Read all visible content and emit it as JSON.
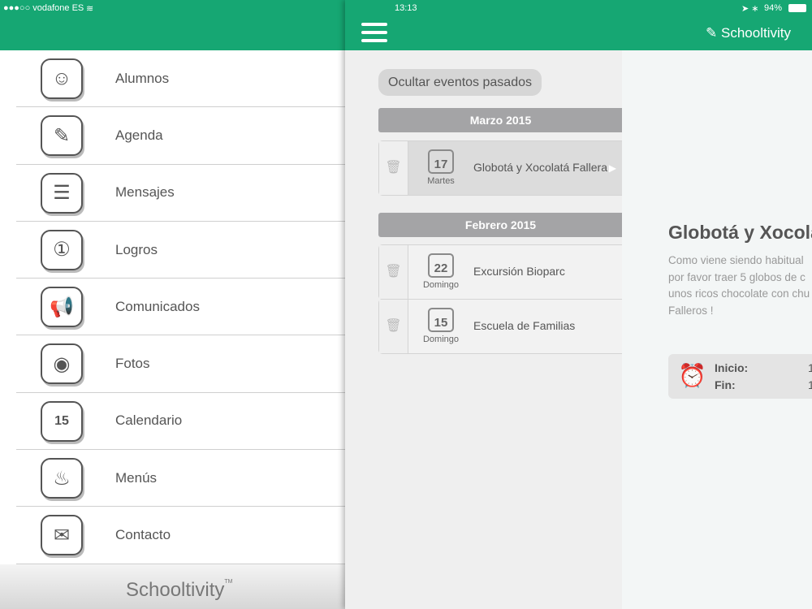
{
  "status": {
    "carrier": "●●●○○ vodafone ES",
    "time": "13:13",
    "battery": "94%"
  },
  "menu": [
    {
      "label": "Alumnos",
      "icon": "☺"
    },
    {
      "label": "Agenda",
      "icon": "✎"
    },
    {
      "label": "Mensajes",
      "icon": "☰"
    },
    {
      "label": "Logros",
      "icon": "①"
    },
    {
      "label": "Comunicados",
      "icon": "📢"
    },
    {
      "label": "Fotos",
      "icon": "◉"
    },
    {
      "label": "Calendario",
      "icon": "15"
    },
    {
      "label": "Menús",
      "icon": "♨"
    },
    {
      "label": "Contacto",
      "icon": "✉"
    }
  ],
  "footer": {
    "logo": "Schooltivity",
    "tm": "TM"
  },
  "header": {
    "brand": "Schooltivity"
  },
  "list": {
    "hide_button": "Ocultar eventos pasados",
    "groups": [
      {
        "month": "Marzo 2015",
        "events": [
          {
            "day": "17",
            "dow": "Martes",
            "title": "Globotá y Xocolatá Fallera"
          }
        ]
      },
      {
        "month": "Febrero 2015",
        "events": [
          {
            "day": "22",
            "dow": "Domingo",
            "title": "Excursión Bioparc"
          },
          {
            "day": "15",
            "dow": "Domingo",
            "title": "Escuela de Familias"
          }
        ]
      }
    ]
  },
  "detail": {
    "title": "Globotá y Xocolatá Fallera",
    "lines": [
      "Como viene siendo habitual",
      "por favor traer 5 globos de c",
      "unos ricos chocolate con chu",
      "Falleros !"
    ],
    "start_label": "Inicio:",
    "start_value": "1",
    "end_label": "Fin:",
    "end_value": "1"
  },
  "colors": {
    "brand": "#16a773"
  }
}
